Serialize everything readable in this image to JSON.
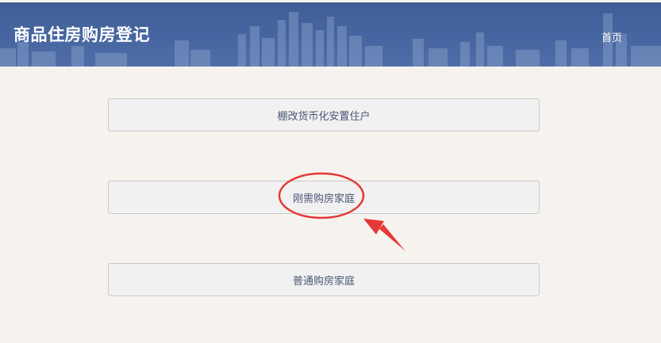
{
  "header": {
    "title": "商品住房购房登记",
    "nav_home": "首页"
  },
  "options": [
    {
      "label": "棚改货币化安置住户"
    },
    {
      "label": "刚需购房家庭"
    },
    {
      "label": "普通购房家庭"
    }
  ],
  "colors": {
    "header_bg": "#4766a1",
    "page_bg": "#f6f3ee",
    "button_bg": "#f1f1f1",
    "button_text": "#4a5674",
    "annotation": "#e53935"
  }
}
